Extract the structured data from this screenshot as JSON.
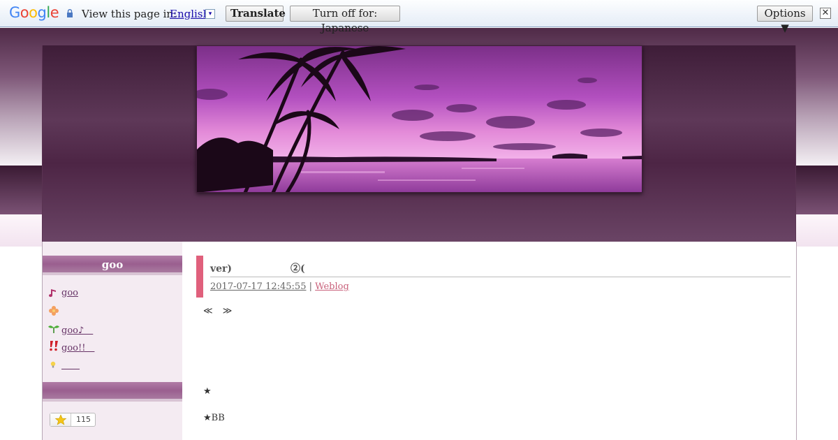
{
  "translate_bar": {
    "logo_parts": [
      "G",
      "o",
      "o",
      "g",
      "l",
      "e"
    ],
    "view_text": "View this page in:",
    "language": "English",
    "dropdown_glyph": "▾",
    "translate_label": "Translate",
    "turn_off_label": "Turn off for: Japanese",
    "options_label": "Options ▼",
    "close_glyph": "✕",
    "icons": [
      "lock-icon",
      "close-icon"
    ]
  },
  "colors": {
    "brand_plum": "#5e3858",
    "sidebar_bg": "#f4ebf2",
    "accent_pink": "#e0607c",
    "category_link": "#c8607a"
  },
  "sidebar": {
    "heading": "goo",
    "items": [
      {
        "icon": "music-note-icon",
        "label": "goo"
      },
      {
        "icon": "flower-icon",
        "label": ""
      },
      {
        "icon": "sprout-icon",
        "label": "goo♪　"
      },
      {
        "icon": "exclamation-icon",
        "label": "goo!!　"
      },
      {
        "icon": "lightbulb-icon",
        "label": "　　"
      }
    ],
    "star_count": "115"
  },
  "entry": {
    "title": "ver)　　　　　　②(",
    "date": "2017-07-17 12:45:55",
    "separator": "|",
    "category": "Weblog",
    "nav_prev": "≪",
    "nav_next": "≫",
    "line1": "★",
    "line2": "★BB"
  }
}
